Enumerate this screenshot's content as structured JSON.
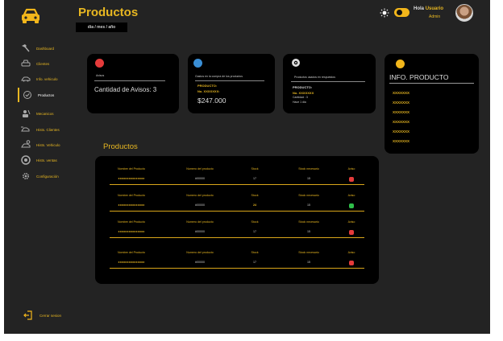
{
  "header": {
    "title": "Productos",
    "date_placeholder": "dia / mes / año",
    "greeting": "Hola",
    "username": "Usuario",
    "role": "Admin"
  },
  "sidebar": {
    "items": [
      {
        "label": "Dashboard",
        "icon": "hammer-icon"
      },
      {
        "label": "Clientes",
        "icon": "car-icon"
      },
      {
        "label": "Info. vehiculo",
        "icon": "car-side-icon"
      },
      {
        "label": "Productos",
        "icon": "check-circle-icon"
      },
      {
        "label": "Mecanicos",
        "icon": "mechanic-icon"
      },
      {
        "label": "Hists. Clientes",
        "icon": "car-history-icon"
      },
      {
        "label": "Hists. Vehiculo",
        "icon": "vehicle-history-icon"
      },
      {
        "label": "Hists. ventas",
        "icon": "tire-icon"
      },
      {
        "label": "Configuración",
        "icon": "gear-icon"
      }
    ],
    "active_index": 3,
    "logout_label": "Cerrar sesion"
  },
  "cards": {
    "avisos": {
      "small_label": "Avisos",
      "main_text": "Cantidad de Avisos:  3"
    },
    "compras": {
      "small_label": "Gastos en la compra de los productos",
      "product_label": "PRODUCTO:",
      "number_label": "No. XXXXXXX:",
      "amount": "$247.000"
    },
    "repuestos": {
      "small_label": "Productos usados en respuestos",
      "product_label": "PRODUCTO:",
      "number_label": "No. XXXXXXX",
      "quantity_label": "Cantidad : 3",
      "time_label": "Hace 1 dia"
    },
    "info": {
      "title": "INFO. PRODUCTO",
      "items": [
        "XXXXXXX",
        "XXXXXXX",
        "XXXXXXX",
        "XXXXXXX",
        "XXXXXXX",
        "XXXXXXX"
      ]
    }
  },
  "products": {
    "section_title": "Productos",
    "headers": [
      "Nombre del Producto",
      "Numero del producto",
      "Stock",
      "Stock necesario",
      "Aviso"
    ],
    "rows": [
      {
        "name": "xxxxxxxxxxxxxxx",
        "number": "#00000",
        "stock": "17",
        "needed": "15",
        "status": "red"
      },
      {
        "name": "xxxxxxxxxxxxxxx",
        "number": "#00000",
        "stock": "24",
        "needed": "15",
        "status": "green"
      },
      {
        "name": "xxxxxxxxxxxxxxx",
        "number": "#00000",
        "stock": "17",
        "needed": "15",
        "status": "red"
      },
      {
        "name": "xxxxxxxxxxxxxxx",
        "number": "#00000",
        "stock": "17",
        "needed": "15",
        "status": "red"
      }
    ]
  },
  "colors": {
    "accent": "#e8b721",
    "background": "#232323",
    "card": "#000000",
    "alert_red": "#e53b3b",
    "ok_green": "#2fbf4a",
    "info_blue": "#3a8fd6"
  }
}
